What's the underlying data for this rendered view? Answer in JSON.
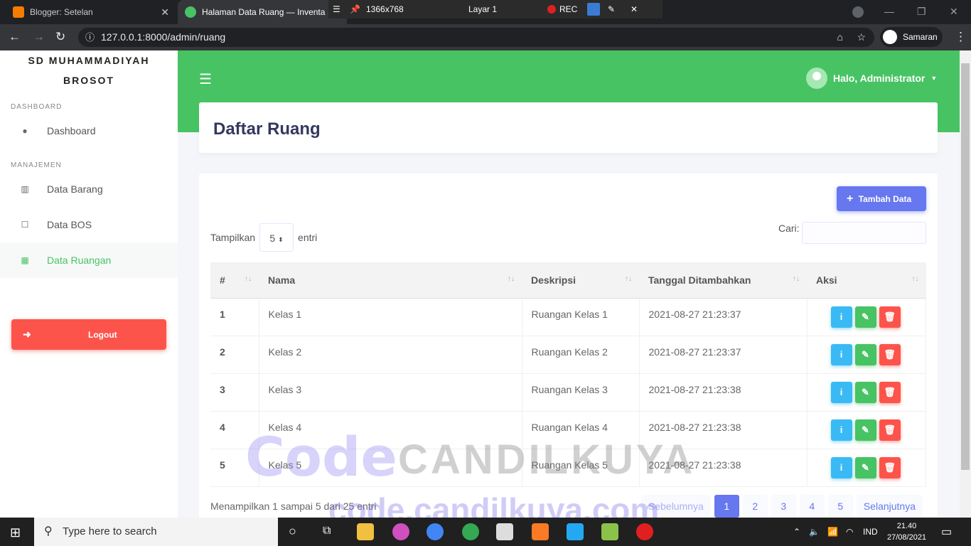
{
  "browser": {
    "tabs": [
      {
        "title": "Blogger: Setelan",
        "icon": "blogger-icon",
        "color": "#f57c00"
      },
      {
        "title": "Halaman Data Ruang — Inventa",
        "icon": "site-icon",
        "color": "#47c363"
      }
    ],
    "recorder": {
      "resolution": "1366x768",
      "layer": "Layar 1",
      "rec_label": "REC"
    },
    "url": "127.0.0.1:8000/admin/ruang",
    "profile": "Samaran"
  },
  "sidebar": {
    "brand_line1": "SD MUHAMMADIYAH",
    "brand_line2": "BROSOT",
    "section_dashboard": "DASHBOARD",
    "section_manajemen": "MANAJEMEN",
    "items": [
      {
        "label": "Dashboard",
        "icon": "fire-icon"
      },
      {
        "label": "Data Barang",
        "icon": "columns-icon"
      },
      {
        "label": "Data BOS",
        "icon": "square-icon"
      },
      {
        "label": "Data Ruangan",
        "icon": "grid-icon"
      }
    ],
    "logout": "Logout"
  },
  "topbar": {
    "greeting": "Halo, Administrator"
  },
  "page": {
    "title": "Daftar Ruang"
  },
  "table_controls": {
    "add_button": "Tambah Data",
    "show_label": "Tampilkan",
    "page_size": "5",
    "entries_label": "entri",
    "search_label": "Cari:"
  },
  "table": {
    "headers": [
      "#",
      "Nama",
      "Deskripsi",
      "Tanggal Ditambahkan",
      "Aksi"
    ],
    "rows": [
      {
        "no": "1",
        "nama": "Kelas 1",
        "deskripsi": "Ruangan Kelas 1",
        "tanggal": "2021-08-27 21:23:37"
      },
      {
        "no": "2",
        "nama": "Kelas 2",
        "deskripsi": "Ruangan Kelas 2",
        "tanggal": "2021-08-27 21:23:37"
      },
      {
        "no": "3",
        "nama": "Kelas 3",
        "deskripsi": "Ruangan Kelas 3",
        "tanggal": "2021-08-27 21:23:38"
      },
      {
        "no": "4",
        "nama": "Kelas 4",
        "deskripsi": "Ruangan Kelas 4",
        "tanggal": "2021-08-27 21:23:38"
      },
      {
        "no": "5",
        "nama": "Kelas 5",
        "deskripsi": "Ruangan Kelas 5",
        "tanggal": "2021-08-27 21:23:38"
      }
    ]
  },
  "footer": {
    "info": "Menampilkan 1 sampai 5 dari 25 entri",
    "prev": "Sebelumnya",
    "pages": [
      "1",
      "2",
      "3",
      "4",
      "5"
    ],
    "next": "Selanjutnya"
  },
  "watermark": {
    "text1": "Code",
    "text2": "CANDILKUYA",
    "text3": "code.candilkuya.com"
  },
  "taskbar": {
    "search_placeholder": "Type here to search",
    "lang": "IND",
    "time": "21.40",
    "date": "27/08/2021"
  },
  "colors": {
    "primary": "#6777ef",
    "success": "#47c363",
    "info": "#3abaf4",
    "danger": "#fc544b"
  }
}
